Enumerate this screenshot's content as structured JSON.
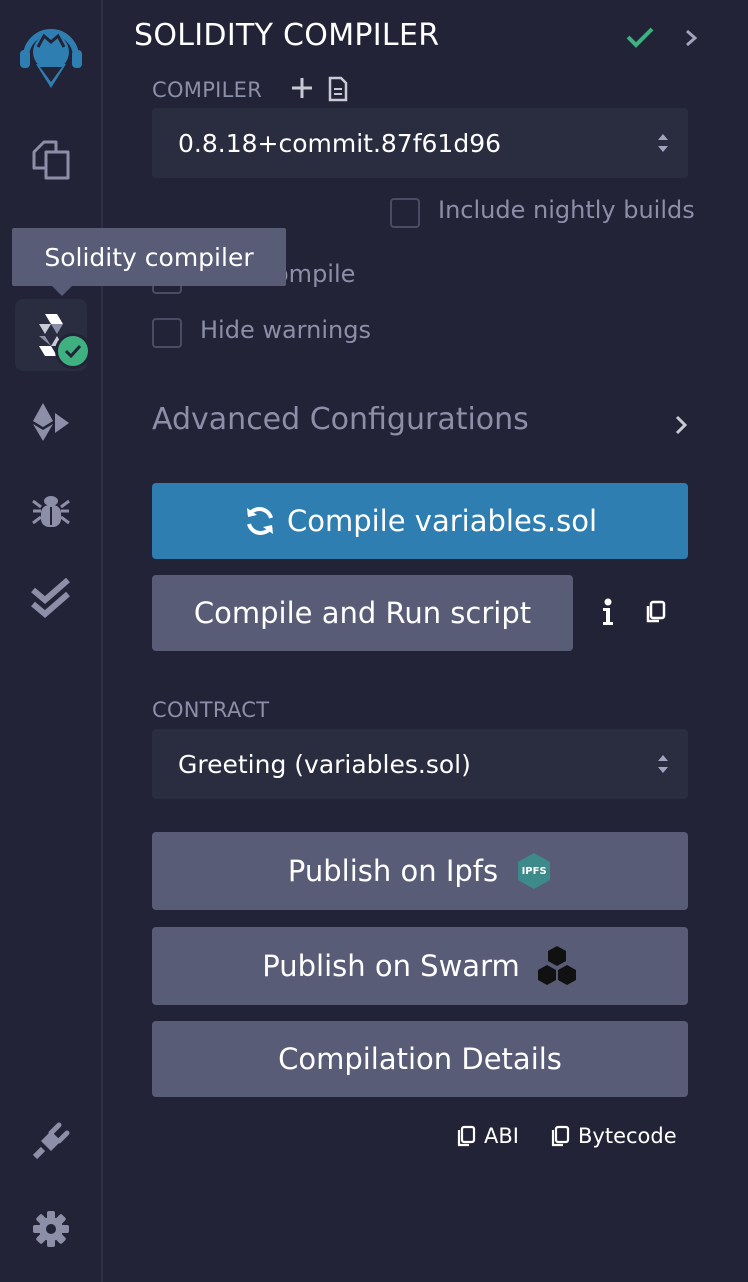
{
  "colors": {
    "background": "#222336",
    "primary": "#2f7eb1",
    "secondary": "#595c76",
    "success": "#3fb07f",
    "text": "#a2a3bd"
  },
  "iconbar": {
    "logo_icon": "remix-logo-icon",
    "items": [
      {
        "name": "file-explorer-icon"
      },
      {
        "name": "solidity-compiler-icon",
        "active": true,
        "badge": "check-icon"
      },
      {
        "name": "deploy-run-icon"
      },
      {
        "name": "debugger-icon"
      },
      {
        "name": "unit-testing-icon"
      }
    ],
    "bottom": [
      {
        "name": "plugin-manager-icon"
      },
      {
        "name": "settings-icon"
      }
    ]
  },
  "tooltip": {
    "text": "Solidity compiler"
  },
  "panel": {
    "title": "SOLIDITY COMPILER",
    "compiler_label": "COMPILER",
    "compiler_version": "0.8.18+commit.87f61d96",
    "nightly_label": "Include nightly builds",
    "auto_compile_label": "Auto compile",
    "auto_compile_visible": "ompile",
    "hide_warnings_label": "Hide warnings",
    "advanced_label": "Advanced Configurations",
    "compile_button": "Compile variables.sol",
    "compile_run_button": "Compile and Run script",
    "contract_label": "CONTRACT",
    "contract_selected": "Greeting (variables.sol)",
    "publish_ipfs": "Publish on Ipfs",
    "ipfs_badge": "IPFS",
    "publish_swarm": "Publish on Swarm",
    "compilation_details": "Compilation Details",
    "abi_label": "ABI",
    "bytecode_label": "Bytecode"
  }
}
